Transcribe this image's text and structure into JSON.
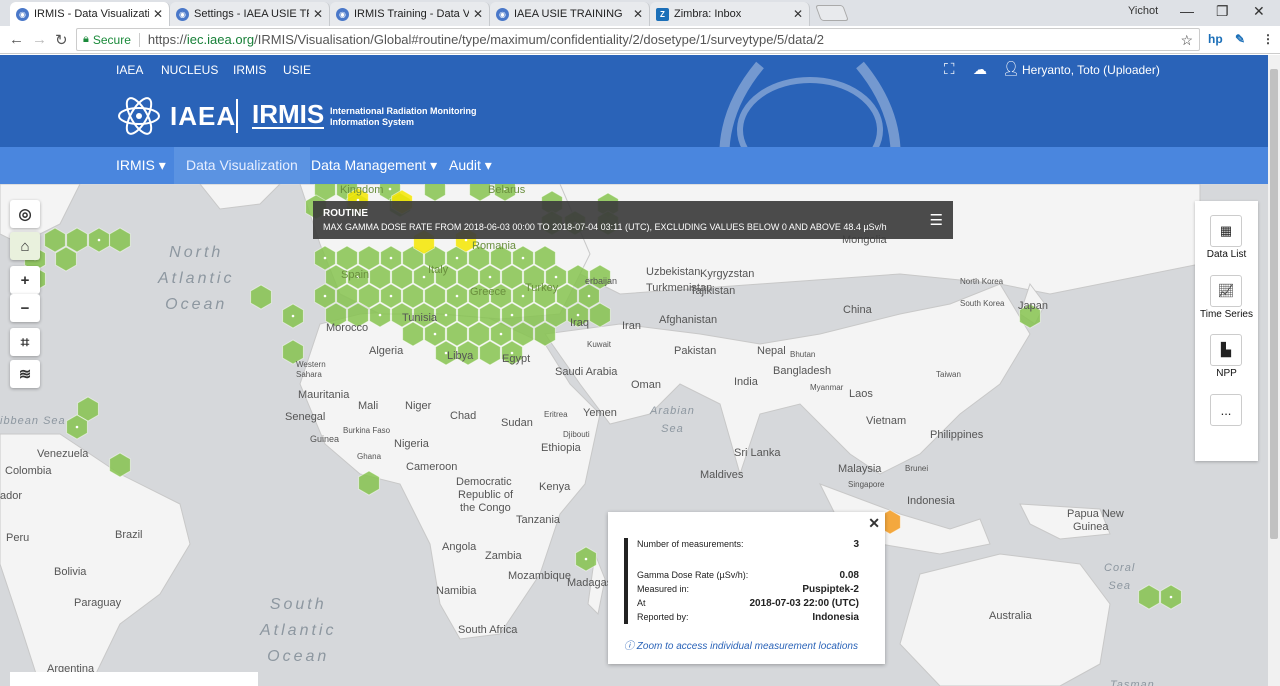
{
  "browser": {
    "tabs": [
      {
        "title": "IRMIS - Data Visualizatio",
        "icon": "iaea-icon"
      },
      {
        "title": "Settings - IAEA USIE TRA",
        "icon": "iaea-icon"
      },
      {
        "title": "IRMIS Training - Data Visu",
        "icon": "iaea-icon"
      },
      {
        "title": "IAEA USIE TRAINING",
        "icon": "iaea-icon"
      },
      {
        "title": "Zimbra: Inbox",
        "icon": "zimbra-icon"
      }
    ],
    "window_user": "Yichot",
    "secure_label": "Secure",
    "url_scheme": "https://",
    "url_host": "iec.iaea.org",
    "url_path": "/IRMIS/Visualisation/Global#routine/type/maximum/confidentiality/2/dosetype/1/surveytype/5/data/2"
  },
  "topnav": {
    "links": [
      "IAEA",
      "NUCLEUS",
      "IRMIS",
      "USIE"
    ],
    "user": "Heryanto, Toto (Uploader)"
  },
  "banner": {
    "logo": "IAEA",
    "irmis": "IRMIS",
    "subtitle_1": "International Radiation Monitoring",
    "subtitle_2": "Information System"
  },
  "mainnav": {
    "items": [
      "IRMIS ▾",
      "Data Visualization",
      "Data Management ▾",
      "Audit ▾"
    ]
  },
  "routine": {
    "title": "ROUTINE",
    "desc": "MAX GAMMA DOSE RATE FROM 2018-06-03 00:00 TO 2018-07-04 03:11 (UTC), EXCLUDING VALUES BELOW 0 AND ABOVE 48.4 µSv/h"
  },
  "right_panel": {
    "data_list": "Data List",
    "time_series": "Time Series",
    "npp": "NPP",
    "more": "..."
  },
  "popup": {
    "num_label": "Number of measurements:",
    "num_value": "3",
    "gdr_label": "Gamma Dose Rate (µSv/h):",
    "gdr_value": "0.08",
    "measured_label": "Measured in:",
    "measured_value": "Puspiptek-2",
    "at_label": "At",
    "at_value": "2018-07-03 22:00 (UTC)",
    "reported_label": "Reported by:",
    "reported_value": "Indonesia",
    "zoom_text": "Zoom to access individual measurement locations"
  },
  "map": {
    "oceans": {
      "north_atlantic_1": "North",
      "north_atlantic_2": "Atlantic",
      "north_atlantic_3": "Ocean",
      "south_atlantic_1": "South",
      "south_atlantic_2": "Atlantic",
      "south_atlantic_3": "Ocean",
      "arabian_1": "Arabian",
      "arabian_2": "Sea",
      "coral_1": "Coral",
      "coral_2": "Sea",
      "caribbean": "ibbean Sea",
      "tasman": "Tasman"
    },
    "countries": {
      "morocco": "Morocco",
      "algeria": "Algeria",
      "libya": "Libya",
      "egypt": "Egypt",
      "tunisia": "Tunisia",
      "western_sahara_1": "Western",
      "western_sahara_2": "Sahara",
      "mauritania": "Mauritania",
      "mali": "Mali",
      "niger": "Niger",
      "chad": "Chad",
      "sudan": "Sudan",
      "senegal": "Senegal",
      "burkina": "Burkina Faso",
      "nigeria": "Nigeria",
      "ghana": "Ghana",
      "cameroon": "Cameroon",
      "ethiopia": "Ethiopia",
      "eritrea": "Eritrea",
      "djibouti": "Djibouti",
      "guinea": "Guinea",
      "drc_1": "Democratic",
      "drc_2": "Republic of",
      "drc_3": "the Congo",
      "kenya": "Kenya",
      "tanzania": "Tanzania",
      "angola": "Angola",
      "zambia": "Zambia",
      "mozambique": "Mozambique",
      "namibia": "Namibia",
      "south_africa": "South Africa",
      "madagascar": "Madagas",
      "saudi": "Saudi Arabia",
      "yemen": "Yemen",
      "oman": "Oman",
      "iraq": "Iraq",
      "iran": "Iran",
      "kuwait": "Kuwait",
      "afghanistan": "Afghanistan",
      "pakistan": "Pakistan",
      "india": "India",
      "nepal": "Nepal",
      "bhutan": "Bhutan",
      "bangladesh": "Bangladesh",
      "sri_lanka": "Sri Lanka",
      "maldives": "Maldives",
      "china": "China",
      "mongolia": "Mongolia",
      "uzbekistan": "Uzbekistan",
      "kyrgyzstan": "Kyrgyzstan",
      "turkmenistan": "Turkmenistan",
      "tajikistan": "Tajikistan",
      "azerbaijan": "erbaijan",
      "north_korea": "North Korea",
      "south_korea": "South Korea",
      "japan": "Japan",
      "taiwan": "Taiwan",
      "laos": "Laos",
      "vietnam": "Vietnam",
      "philippines": "Philippines",
      "malaysia": "Malaysia",
      "brunei": "Brunei",
      "singapore": "Singapore",
      "indonesia": "Indonesia",
      "png_1": "Papua New",
      "png_2": "Guinea",
      "australia": "Australia",
      "venezuela": "Venezuela",
      "colombia": "Colombia",
      "ecuador": "ador",
      "peru": "Peru",
      "brazil": "Brazil",
      "bolivia": "Bolivia",
      "paraguay": "Paraguay",
      "argentina": "Argentina",
      "spain": "Spain",
      "italy": "Italy",
      "greece": "Greece",
      "turkey": "Turkey",
      "romania": "Romania",
      "belarus": "Belarus",
      "kingdom": "Kingdom",
      "myanmar": "Myanmar"
    }
  },
  "colors": {
    "brand": "#2a63b8",
    "nav": "#4a86de",
    "hex_green": "#86c34f",
    "hex_yellow": "#f5e600",
    "hex_orange": "#f39a1d"
  }
}
